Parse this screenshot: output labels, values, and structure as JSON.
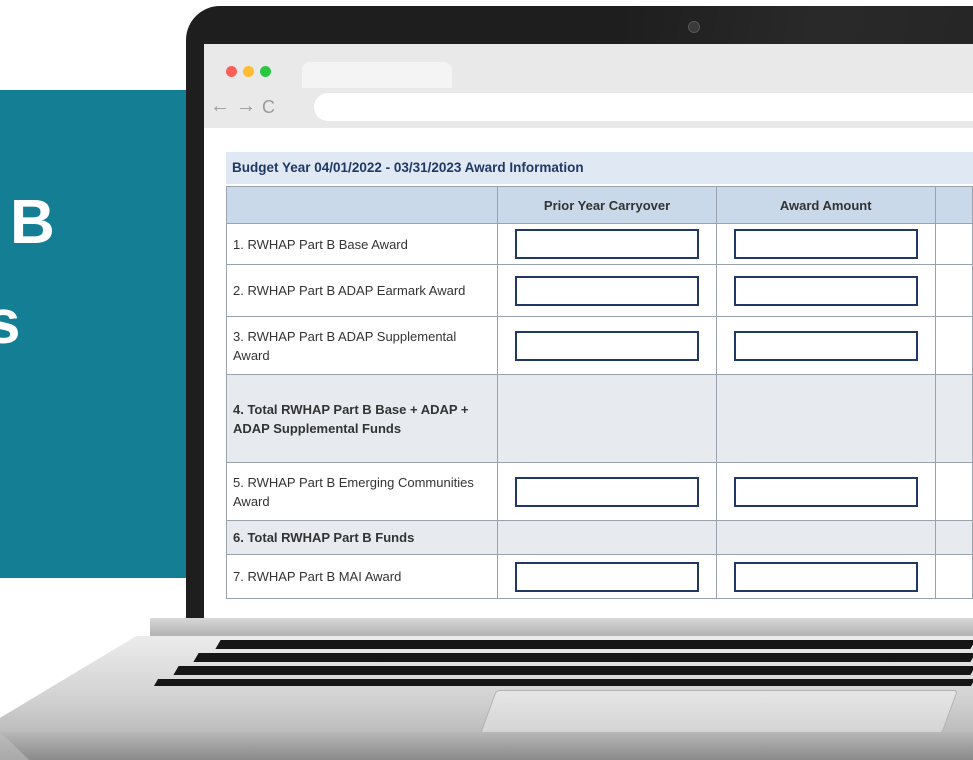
{
  "slide": {
    "side_text_1": "B",
    "side_text_2": "s"
  },
  "colors": {
    "teal_panel": "#137e94",
    "header_band": "#dfe8f3",
    "table_header": "#c9d9ea",
    "input_border": "#1f3864"
  },
  "browser": {
    "traffic_lights": [
      "red",
      "yellow",
      "green"
    ],
    "back_icon": "←",
    "forward_icon": "→",
    "reload_icon": "C"
  },
  "form": {
    "title": "Budget Year 04/01/2022 - 03/31/2023 Award Information",
    "columns": [
      "",
      "Prior Year Carryover",
      "Award Amount"
    ],
    "rows": [
      {
        "label": "1. RWHAP Part B Base Award",
        "total": false
      },
      {
        "label": "2. RWHAP Part B ADAP Earmark Award",
        "total": false
      },
      {
        "label": "3. RWHAP Part B ADAP Supplemental Award",
        "total": false
      },
      {
        "label": "4. Total RWHAP Part B Base + ADAP + ADAP Supplemental Funds",
        "total": true
      },
      {
        "label": "5. RWHAP Part B Emerging Communities Award",
        "total": false
      },
      {
        "label": "6. Total RWHAP Part B Funds",
        "total": true
      },
      {
        "label": "7. RWHAP Part B MAI Award",
        "total": false
      }
    ]
  }
}
